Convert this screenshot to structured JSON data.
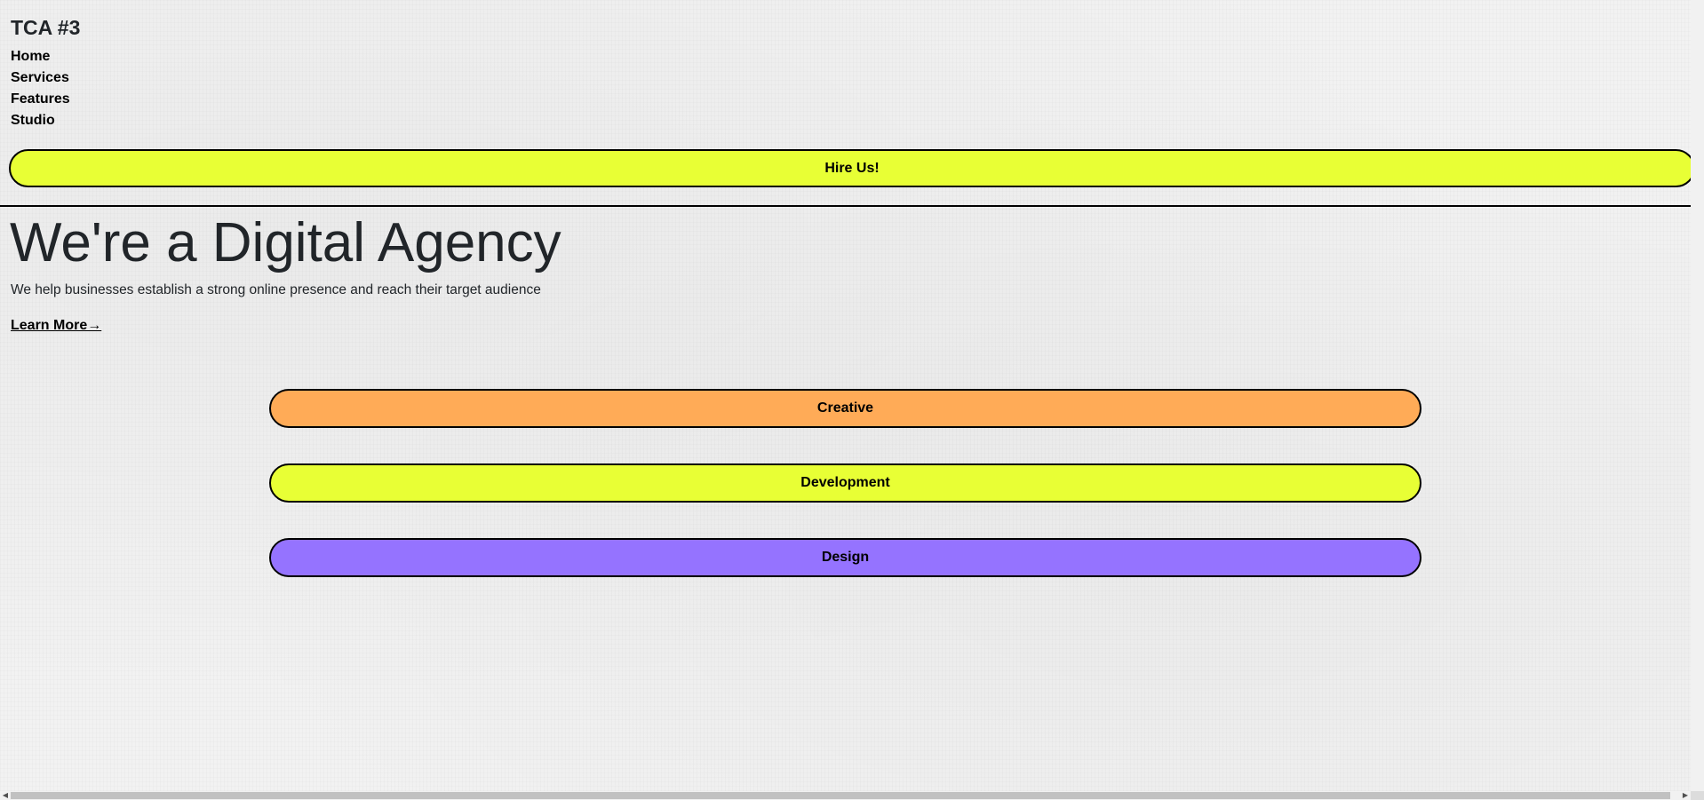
{
  "header": {
    "brand": "TCA #3",
    "nav": [
      "Home",
      "Services",
      "Features",
      "Studio"
    ],
    "cta_label": "Hire Us!"
  },
  "hero": {
    "title": "We're a Digital Agency",
    "subtitle": "We help businesses establish a strong online presence and reach their target audience",
    "link_label": "Learn More→"
  },
  "services": [
    {
      "label": "Creative",
      "color": "#ffab57"
    },
    {
      "label": "Development",
      "color": "#e8ff35"
    },
    {
      "label": "Design",
      "color": "#9573ff"
    }
  ],
  "scrollbar": {
    "left_arrow": "◀",
    "right_arrow": "▶"
  }
}
